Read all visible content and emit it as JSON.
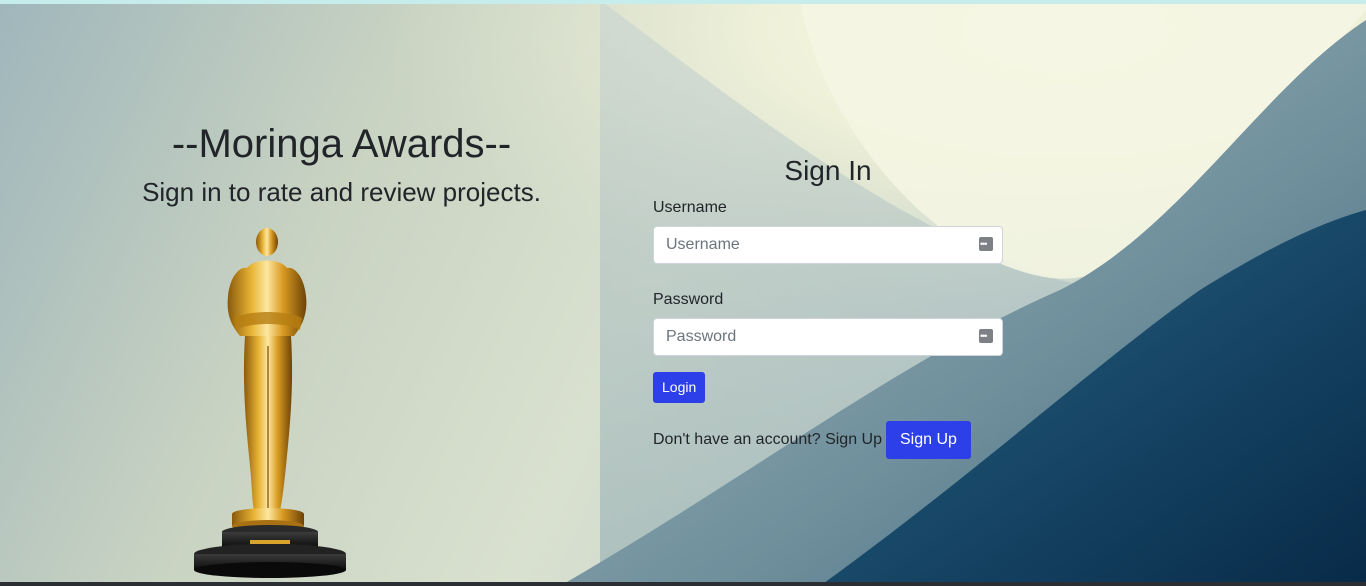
{
  "brand": {
    "title": "--Moringa Awards--",
    "subtitle": "Sign in to rate and review projects."
  },
  "form": {
    "title": "Sign In",
    "username_label": "Username",
    "username_placeholder": "Username",
    "username_value": "",
    "password_label": "Password",
    "password_placeholder": "Password",
    "password_value": "",
    "login_label": "Login",
    "signup_prompt": "Don't have an account? Sign Up",
    "signup_label": "Sign Up"
  },
  "icons": {
    "trophy": "oscar-statuette-icon",
    "password_manager": "password-manager-key-icon"
  },
  "colors": {
    "primary_button": "#2d3fe8",
    "text": "#212529",
    "background_light": "#dfe7d6",
    "background_dark": "#0e3556"
  }
}
